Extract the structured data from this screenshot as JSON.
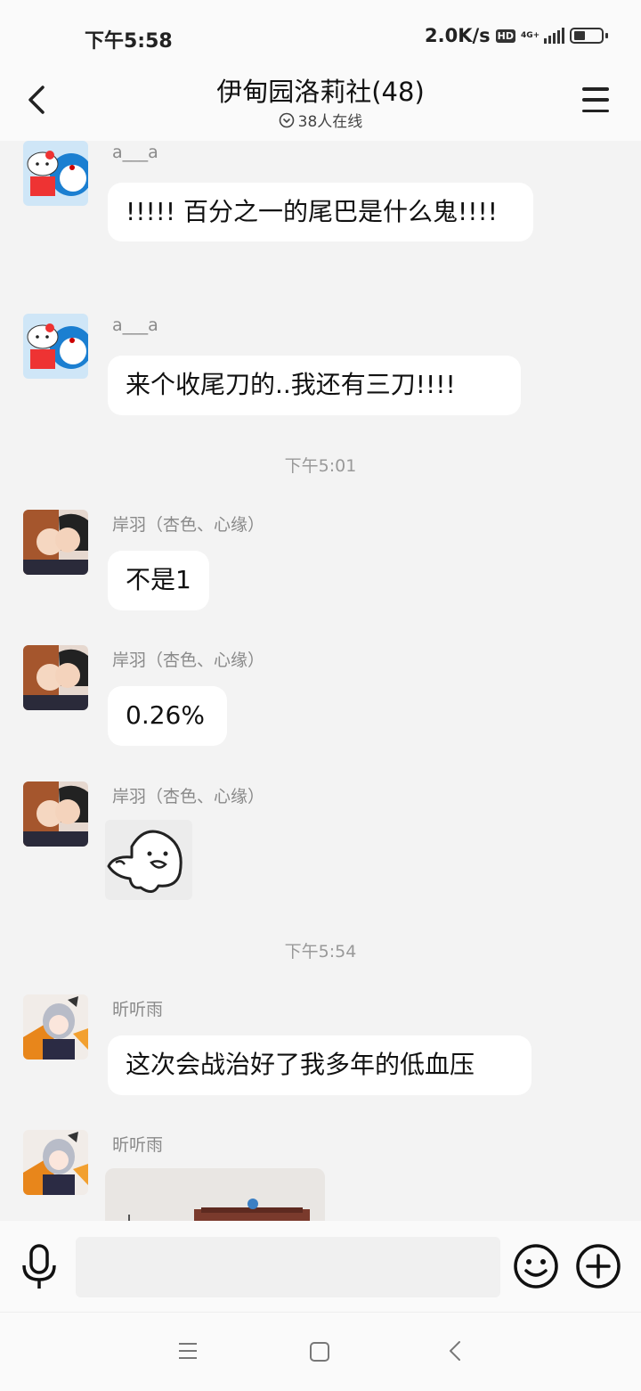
{
  "status_bar": {
    "time": "下午5:58",
    "net_speed": "2.0K/s",
    "hd_badge": "HD",
    "network": "4G+",
    "battery_level": 0.45
  },
  "header": {
    "title": "伊甸园洛莉社(48)",
    "online": "38人在线"
  },
  "messages": [
    {
      "sender": "a___a",
      "text": "!!!!! 百分之一的尾巴是什么鬼!!!!"
    },
    {
      "sender": "a___a",
      "text": "来个收尾刀的..我还有三刀!!!!"
    },
    {
      "timestamp": "下午5:01"
    },
    {
      "sender": "岸羽（杏色、心缘）",
      "text": "不是1"
    },
    {
      "sender": "岸羽（杏色、心缘）",
      "text": "0.26%"
    },
    {
      "sender": "岸羽（杏色、心缘）",
      "sticker": "ghost-doodle-sticker"
    },
    {
      "timestamp": "下午5:54"
    },
    {
      "sender": "昕听雨",
      "text": "这次会战治好了我多年的低血压"
    },
    {
      "sender": "昕听雨",
      "image": "photo-preview"
    }
  ],
  "colors": {
    "background": "#f3f3f3",
    "bubble": "#ffffff",
    "bar": "#fafafa",
    "muted": "#8a8a8a"
  },
  "icons": [
    "back-icon",
    "menu-icon",
    "online-check-icon",
    "microphone-icon",
    "emoji-icon",
    "plus-icon",
    "nav-menu-icon",
    "nav-home-icon",
    "nav-back-icon"
  ]
}
